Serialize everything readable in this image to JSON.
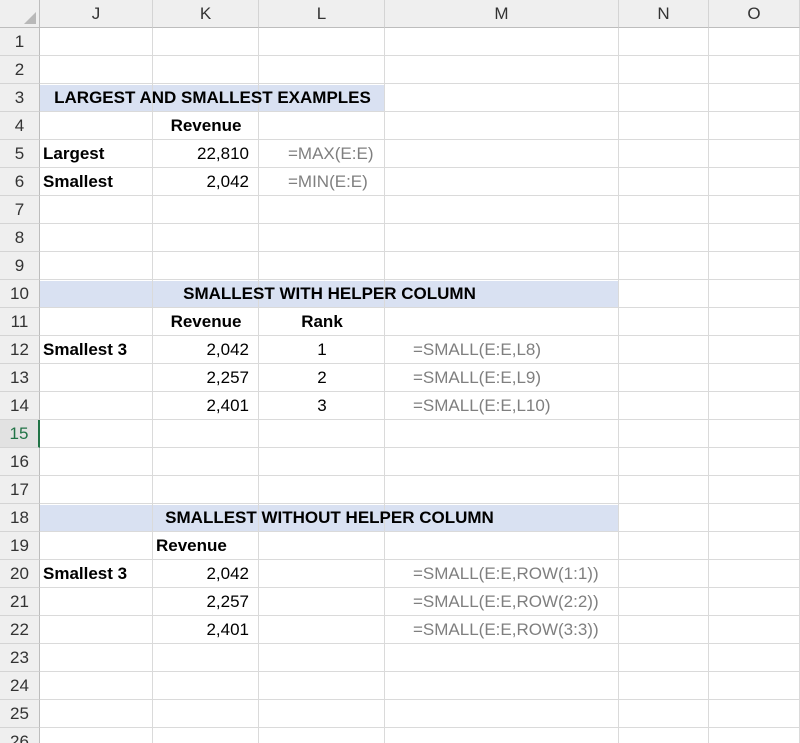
{
  "columns": [
    "J",
    "K",
    "L",
    "M",
    "N",
    "O"
  ],
  "rows": [
    "1",
    "2",
    "3",
    "4",
    "5",
    "6",
    "7",
    "8",
    "9",
    "10",
    "11",
    "12",
    "13",
    "14",
    "15",
    "16",
    "17",
    "18",
    "19",
    "20",
    "21",
    "22",
    "23",
    "24",
    "25",
    "26"
  ],
  "active_row": "15",
  "section1": {
    "title": "LARGEST AND SMALLEST EXAMPLES",
    "header": "Revenue",
    "largest_label": "Largest",
    "largest_value": "22,810",
    "largest_formula": "=MAX(E:E)",
    "smallest_label": "Smallest",
    "smallest_value": "2,042",
    "smallest_formula": "=MIN(E:E)"
  },
  "section2": {
    "title": "SMALLEST WITH HELPER COLUMN",
    "header_revenue": "Revenue",
    "header_rank": "Rank",
    "label": "Smallest 3",
    "rows": [
      {
        "value": "2,042",
        "rank": "1",
        "formula": "=SMALL(E:E,L8)"
      },
      {
        "value": "2,257",
        "rank": "2",
        "formula": "=SMALL(E:E,L9)"
      },
      {
        "value": "2,401",
        "rank": "3",
        "formula": "=SMALL(E:E,L10)"
      }
    ]
  },
  "section3": {
    "title": "SMALLEST WITHOUT HELPER COLUMN",
    "header_revenue": "Revenue",
    "label": "Smallest 3",
    "rows": [
      {
        "value": "2,042",
        "formula": "=SMALL(E:E,ROW(1:1))"
      },
      {
        "value": "2,257",
        "formula": "=SMALL(E:E,ROW(2:2))"
      },
      {
        "value": "2,401",
        "formula": "=SMALL(E:E,ROW(3:3))"
      }
    ]
  },
  "colors": {
    "band": "#d9e1f2",
    "formula_text": "#7f7f7f",
    "active_header": "#217346"
  }
}
